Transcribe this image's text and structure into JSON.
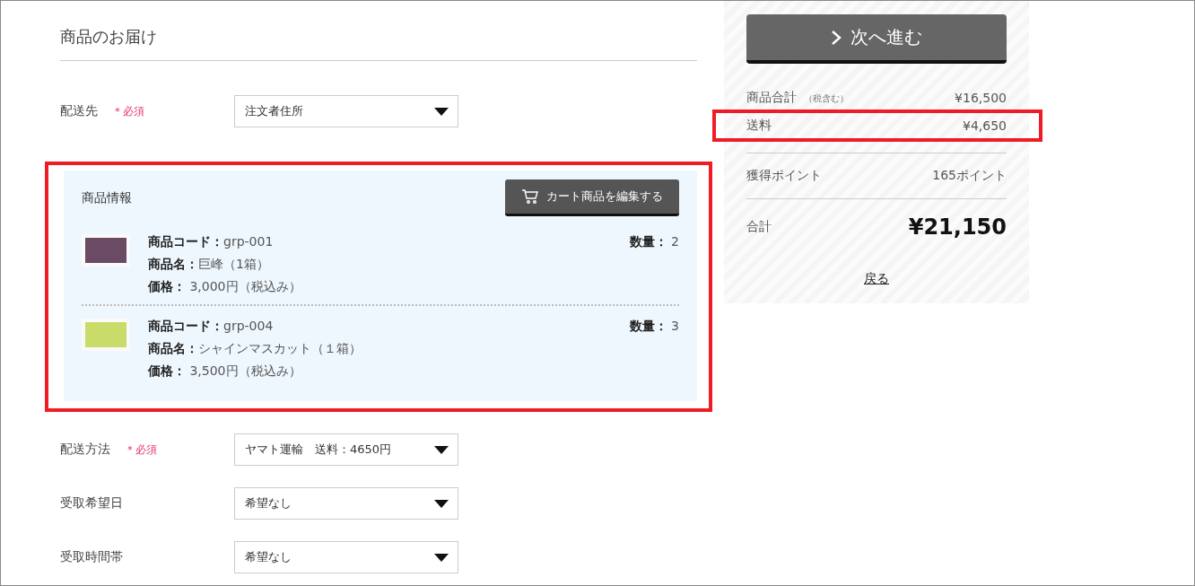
{
  "heading": "商品のお届け",
  "sections": [
    {
      "kind": "select",
      "label": "配送先",
      "required": "＊必須",
      "value": "注文者住所"
    },
    {
      "kind": "products",
      "title": "商品情報",
      "highlighted": true,
      "edit_button": "カート商品を編集する",
      "items": [
        {
          "kind": "dark",
          "lines": [
            "**商品コード：**grp-001",
            "**商品名：**巨峰（1箱）",
            "**価格：** 3,000円（税込み）"
          ],
          "quantity": "**数量：** 2"
        },
        {
          "kind": "light",
          "lines": [
            "**商品コード：**grp-004",
            "**商品名：**シャインマスカット（１箱）",
            "**価格：** 3,500円（税込み）"
          ],
          "quantity": "**数量：** 3"
        }
      ]
    },
    {
      "kind": "select",
      "label": "配送方法",
      "required": "＊必須",
      "value": "ヤマト運輸　送料：4650円"
    },
    {
      "kind": "select",
      "label": "受取希望日",
      "value": "希望なし"
    },
    {
      "kind": "select",
      "label": "受取時間帯",
      "value": "希望なし"
    }
  ],
  "summary": {
    "next_button": "次へ進む",
    "rows": [
      {
        "kind": "line",
        "label": "商品合計",
        "note": "（税含む）",
        "value": "¥16,500",
        "highlighted": false
      },
      {
        "kind": "line",
        "label": "送料",
        "value": "¥4,650",
        "highlighted": true
      },
      {
        "kind": "points",
        "label": "獲得ポイント",
        "value": "165ポイント",
        "highlighted": false
      },
      {
        "kind": "total",
        "label": "合計",
        "value": "¥21,150",
        "highlighted": false
      }
    ],
    "back_link": "戻る"
  }
}
